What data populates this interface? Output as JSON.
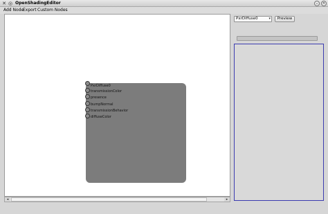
{
  "window": {
    "title": "OpenShadingEditor",
    "icons": {
      "app": "close-x-icon",
      "pin": "pin-icon",
      "minimize": "minimize-icon",
      "close": "close-icon"
    }
  },
  "menu": {
    "items": [
      "Add Node",
      "Export",
      "Custom Nodes"
    ]
  },
  "node": {
    "name": "PxrDiffuse0",
    "ports": [
      "transmissionColor",
      "presence",
      "bumpNormal",
      "transmissionBehavior",
      "diffuseColor"
    ]
  },
  "controls": {
    "node_select": "PxrDiffuse0",
    "preview_label": "Preview"
  },
  "render_progress": 0,
  "colors": {
    "panel_border": "#3a3ab0",
    "node_fill": "#7c7c7c",
    "canvas_bg": "#ffffff"
  }
}
